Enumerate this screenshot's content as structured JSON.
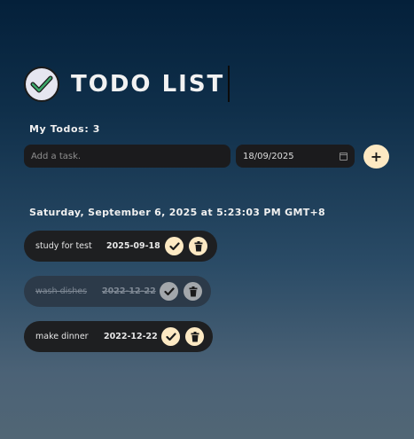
{
  "header": {
    "title": "TODO LIST",
    "logo_icon": "check-circle-icon"
  },
  "summary": {
    "label": "My Todos: 3"
  },
  "form": {
    "task_placeholder": "Add a task.",
    "date_value": "18/09/2025",
    "add_label": "+"
  },
  "datetime": "Saturday, September 6, 2025 at 5:23:03 PM GMT+8",
  "todos": [
    {
      "task": "study for test",
      "date": "2025-09-18",
      "done": false
    },
    {
      "task": "wash dishes",
      "date": "2022-12-22",
      "done": true
    },
    {
      "task": "make dinner",
      "date": "2022-12-22",
      "done": false
    }
  ],
  "colors": {
    "accent": "#fde9c3",
    "item_bg": "#1e1f21",
    "item_done_bg": "#2c3a49",
    "logo_check": "#3da86a"
  }
}
